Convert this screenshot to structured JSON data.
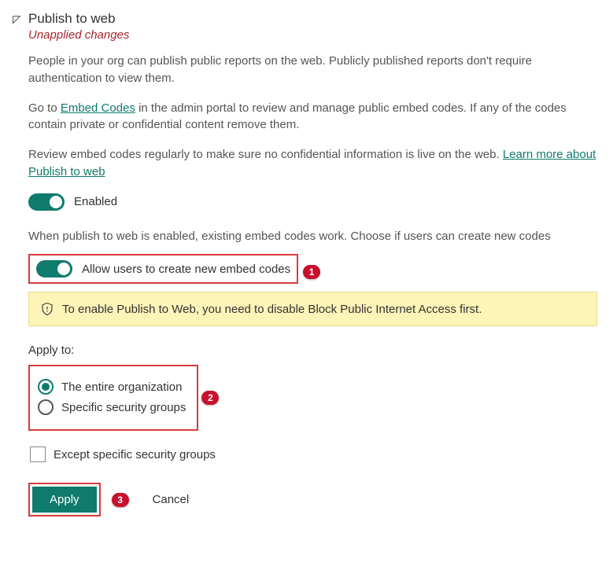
{
  "header": {
    "title": "Publish to web",
    "status": "Unapplied changes"
  },
  "paragraphs": {
    "p1": "People in your org can publish public reports on the web. Publicly published reports don't require authentication to view them.",
    "p2_a": "Go to  ",
    "p2_link": "Embed Codes",
    "p2_b": " in the admin portal to review and manage public embed codes. If any of the codes contain private or confidential content remove them.",
    "p3_a": "Review embed codes regularly to make sure no confidential information is live on the web.  ",
    "p3_link": "Learn more about Publish to web"
  },
  "enabled": {
    "label": "Enabled"
  },
  "subhead": "When publish to web is enabled, existing embed codes work. Choose if users can create new codes",
  "allow": {
    "label": "Allow users to create new embed codes"
  },
  "warning": "To enable Publish to Web, you need to disable Block Public Internet Access first.",
  "applyTo": {
    "label": "Apply to:",
    "opt1": "The entire organization",
    "opt2": "Specific security groups",
    "except": "Except specific security groups"
  },
  "buttons": {
    "apply": "Apply",
    "cancel": "Cancel"
  },
  "callouts": {
    "c1": "1",
    "c2": "2",
    "c3": "3"
  }
}
